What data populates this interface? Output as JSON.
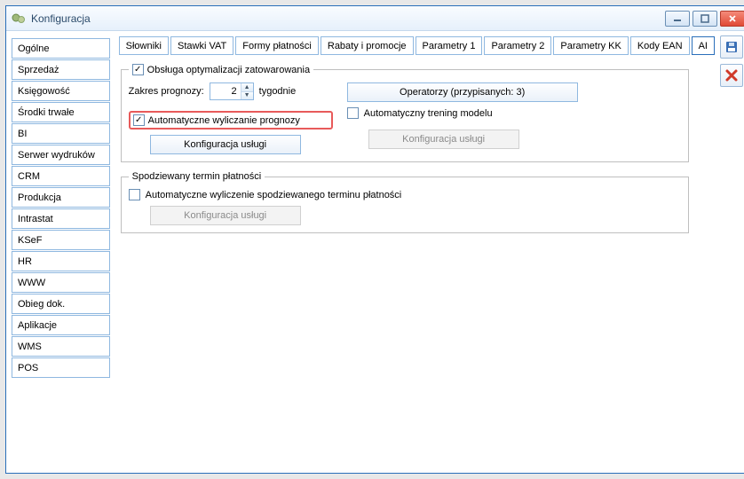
{
  "window": {
    "title": "Konfiguracja"
  },
  "sidebar": {
    "items": [
      "Ogólne",
      "Sprzedaż",
      "Księgowość",
      "Środki trwałe",
      "BI",
      "Serwer wydruków",
      "CRM",
      "Produkcja",
      "Intrastat",
      "KSeF",
      "HR",
      "WWW",
      "Obieg dok.",
      "Aplikacje",
      "WMS",
      "POS"
    ]
  },
  "tabs": {
    "items": [
      "Słowniki",
      "Stawki VAT",
      "Formy płatności",
      "Rabaty i promocje",
      "Parametry 1",
      "Parametry 2",
      "Parametry KK",
      "Kody EAN",
      "AI"
    ],
    "active_index": 8
  },
  "ai": {
    "box1": {
      "legend_label": "Obsługa optymalizacji zatowarowania",
      "legend_checked": true,
      "range_label": "Zakres prognozy:",
      "range_value": "2",
      "range_unit": "tygodnie",
      "operators_button": "Operatorzy (przypisanych: 3)",
      "auto_calc_checked": true,
      "auto_calc_label": "Automatyczne wyliczanie prognozy",
      "auto_train_checked": false,
      "auto_train_label": "Automatyczny trening modelu",
      "config_button": "Konfiguracja usługi",
      "config_button2": "Konfiguracja usługi"
    },
    "box2": {
      "legend_label": "Spodziewany termin płatności",
      "auto_checked": false,
      "auto_label": "Automatyczne wyliczenie spodziewanego terminu płatności",
      "config_button": "Konfiguracja usługi"
    }
  }
}
